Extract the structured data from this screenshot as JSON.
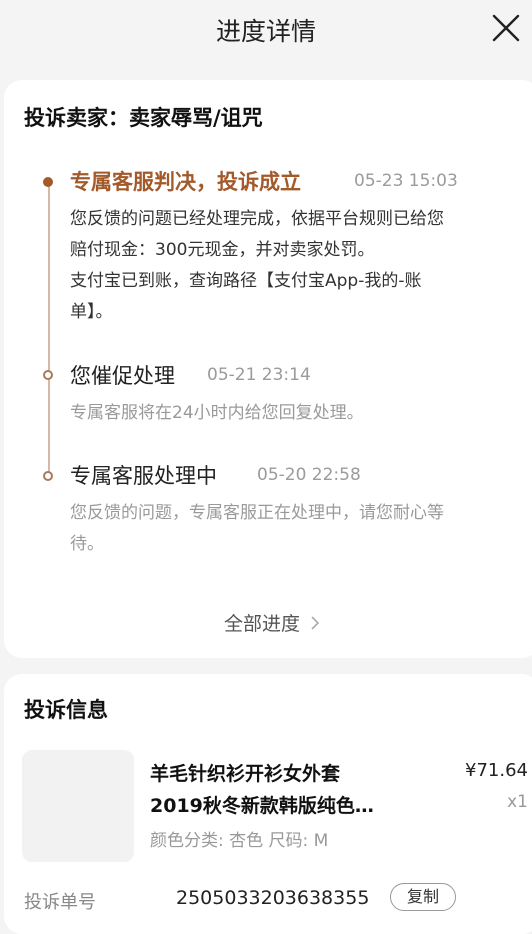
{
  "header": {
    "title": "进度详情",
    "close_icon": "close-icon"
  },
  "progress": {
    "title": "投诉卖家：卖家辱骂/诅咒",
    "steps": [
      {
        "title": "专属客服判决，投诉成立",
        "time": "05-23 15:03",
        "status": "active",
        "desc_lines": [
          "您反馈的问题已经处理完成，依据平台规则已给您",
          "赔付现金：300元现金，并对卖家处罚。",
          "支付宝已到账，查询路径【支付宝App-我的-账",
          "单】。"
        ]
      },
      {
        "title": "您催促处理",
        "time": "05-21 23:14",
        "status": "done",
        "desc_lines": [
          "专属客服将在24小时内给您回复处理。"
        ]
      },
      {
        "title": "专属客服处理中",
        "time": "05-20 22:58",
        "status": "done",
        "desc_lines": [
          "您反馈的问题，专属客服正在处理中，请您耐心等",
          "待。"
        ]
      }
    ],
    "all_progress_label": "全部进度",
    "chevron_icon": "chevron-right-icon"
  },
  "complaint_info": {
    "title": "投诉信息",
    "product": {
      "title_lines": [
        "羊毛针织衫开衫女外套",
        "2019秋冬新款韩版纯色…"
      ],
      "sku": "颜色分类: 杏色 尺码: M",
      "price": "¥71.64",
      "quantity": "x1"
    },
    "order_label": "投诉单号",
    "order_number": "2505033203638355",
    "copy_label": "复制"
  },
  "colors": {
    "accent": "#a35a2b",
    "timeline": "#d5b9a6",
    "muted_text": "#9a9a9a",
    "background": "#f4f4f4"
  }
}
